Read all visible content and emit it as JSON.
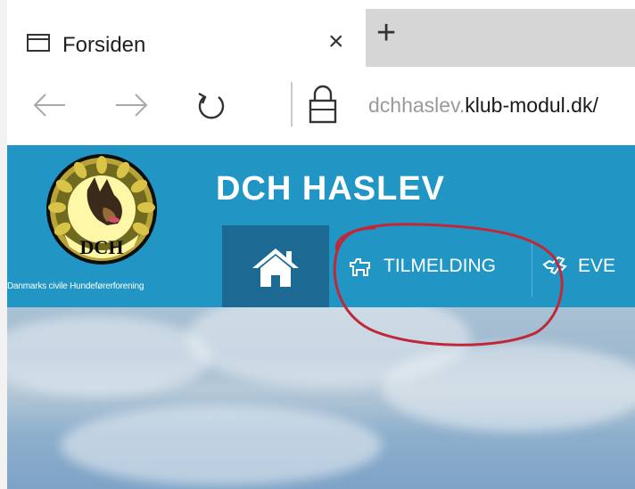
{
  "browser": {
    "tab": {
      "title": "Forsiden",
      "close_glyph": "×",
      "icon": "tab-page-icon"
    },
    "new_tab_glyph": "+",
    "nav": {
      "back_glyph": "←",
      "forward_glyph": "→",
      "refresh_icon": "refresh-icon",
      "lock_icon": "lock-icon"
    },
    "url": {
      "subdomain": "dchhaslev.",
      "domain": "klub-modul.dk/"
    }
  },
  "site": {
    "title": "DCH HASLEV",
    "logo_text": "DCH",
    "org_name": "Danmarks civile Hundeførerforening",
    "menu": [
      {
        "label": "TILMELDING",
        "icon": "dog-icon"
      },
      {
        "label": "EVE",
        "icon": "dog-jump-icon"
      }
    ],
    "colors": {
      "header": "#2196c4",
      "home_tab": "#1c6a93",
      "annotation": "#c0283a"
    }
  }
}
